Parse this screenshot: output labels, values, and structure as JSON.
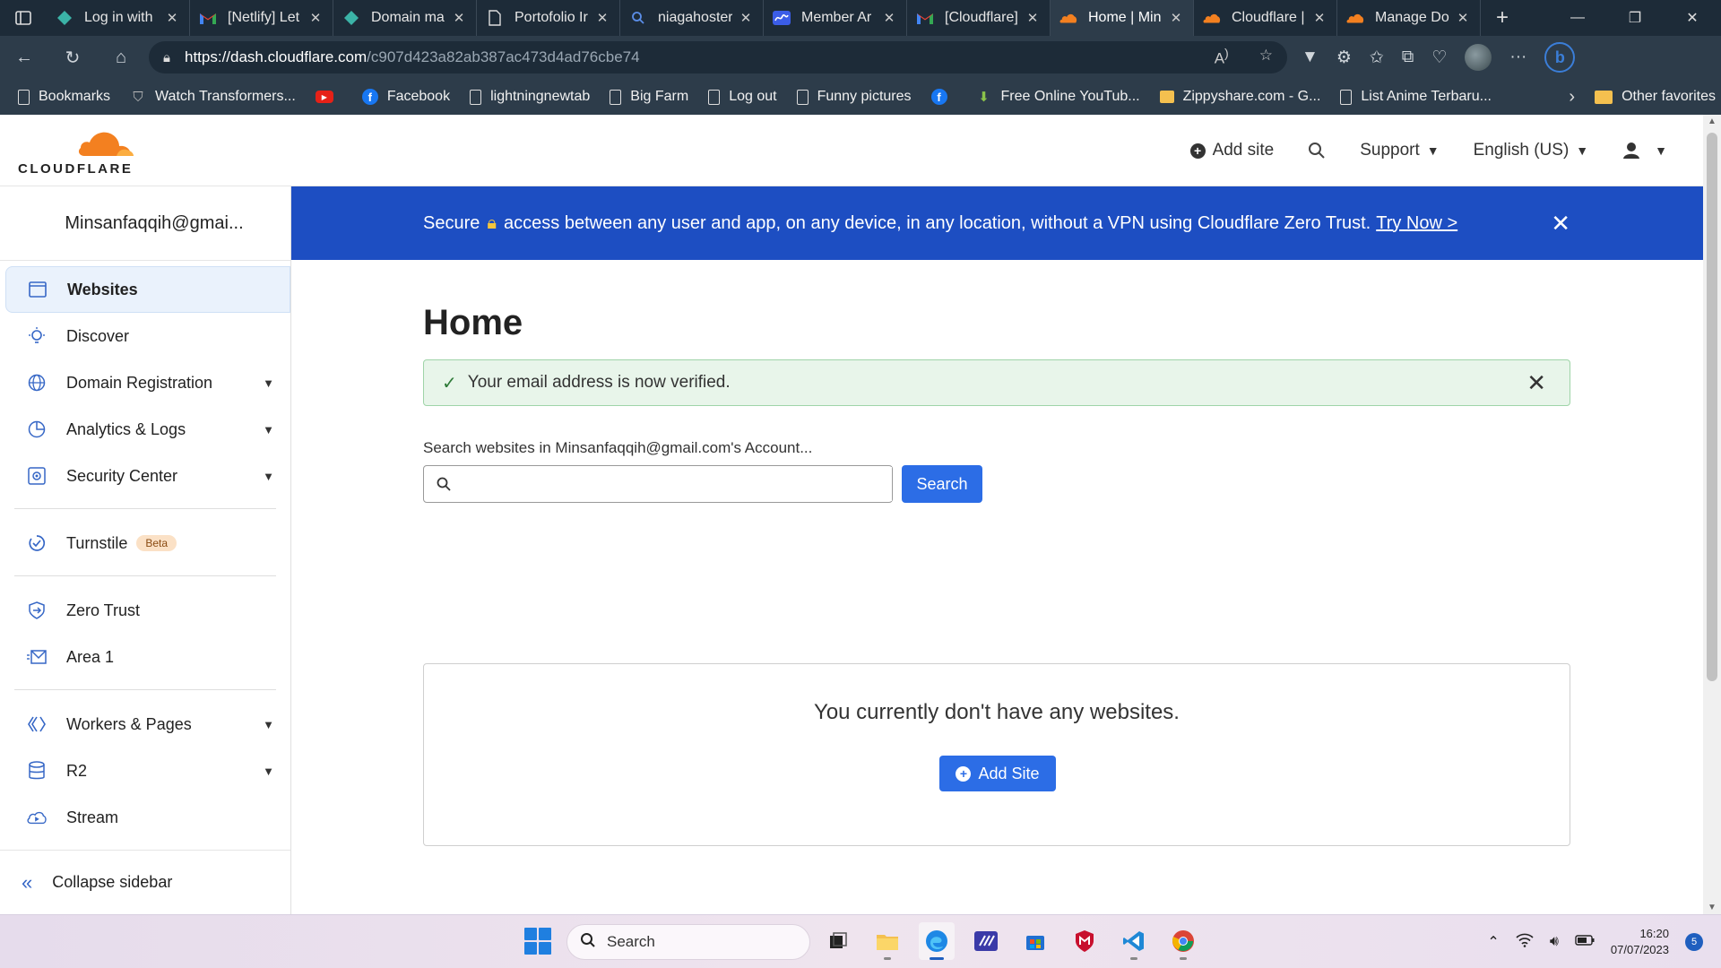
{
  "browser": {
    "tabs": [
      {
        "title": "Log in with",
        "icon": "netlify-icon",
        "active": false
      },
      {
        "title": "[Netlify] Let",
        "icon": "gmail-icon",
        "active": false
      },
      {
        "title": "Domain ma",
        "icon": "netlify-icon",
        "active": false
      },
      {
        "title": "Portofolio Ir",
        "icon": "page-icon",
        "active": false
      },
      {
        "title": "niagahoster",
        "icon": "search-icon",
        "active": false
      },
      {
        "title": "Member Ar",
        "icon": "niagahoster-icon",
        "active": false
      },
      {
        "title": "[Cloudflare]",
        "icon": "gmail-icon",
        "active": false
      },
      {
        "title": "Home | Min",
        "icon": "cloudflare-icon",
        "active": true
      },
      {
        "title": "Cloudflare |",
        "icon": "cloudflare-icon",
        "active": false
      },
      {
        "title": "Manage Do",
        "icon": "cloudflare-icon",
        "active": false
      }
    ],
    "url_host": "https://dash.cloudflare.com",
    "url_path": "/c907d423a82ab387ac473d4ad76cbe74",
    "bookmarks": [
      {
        "label": "Bookmarks",
        "icon": "page"
      },
      {
        "label": "Watch Transformers...",
        "icon": "transformers"
      },
      {
        "label": "",
        "icon": "yt"
      },
      {
        "label": "Facebook",
        "icon": "fb"
      },
      {
        "label": "lightningnewtab",
        "icon": "page"
      },
      {
        "label": "Big Farm",
        "icon": "page"
      },
      {
        "label": "Log out",
        "icon": "page"
      },
      {
        "label": "Funny pictures",
        "icon": "page"
      },
      {
        "label": "",
        "icon": "fb"
      },
      {
        "label": "Free Online YouTub...",
        "icon": "download"
      },
      {
        "label": "Zippyshare.com - G...",
        "icon": "zippy"
      },
      {
        "label": "List Anime Terbaru...",
        "icon": "page"
      }
    ],
    "other_favorites": "Other favorites"
  },
  "header": {
    "logo_text": "CLOUDFLARE",
    "add_site": "Add site",
    "support": "Support",
    "language": "English (US)"
  },
  "sidebar": {
    "account": "Minsanfaqqih@gmai...",
    "group1": [
      {
        "label": "Websites",
        "icon": "websites-icon",
        "active": true,
        "caret": false
      },
      {
        "label": "Discover",
        "icon": "lightbulb-icon",
        "active": false,
        "caret": false
      },
      {
        "label": "Domain Registration",
        "icon": "globe-icon",
        "active": false,
        "caret": true
      },
      {
        "label": "Analytics & Logs",
        "icon": "pie-chart-icon",
        "active": false,
        "caret": true
      },
      {
        "label": "Security Center",
        "icon": "security-icon",
        "active": false,
        "caret": true
      }
    ],
    "turnstile": {
      "label": "Turnstile",
      "badge": "Beta"
    },
    "group3": [
      {
        "label": "Zero Trust",
        "icon": "zero-trust-icon"
      },
      {
        "label": "Area 1",
        "icon": "mail-icon"
      }
    ],
    "group4": [
      {
        "label": "Workers & Pages",
        "icon": "workers-icon",
        "caret": true
      },
      {
        "label": "R2",
        "icon": "database-icon",
        "caret": true
      },
      {
        "label": "Stream",
        "icon": "stream-icon",
        "caret": false
      }
    ],
    "collapse": "Collapse sidebar"
  },
  "banner": {
    "before": "Secure",
    "after": "access between any user and app, on any device, in any location, without a VPN using Cloudflare Zero Trust.",
    "link": "Try Now >"
  },
  "main": {
    "title": "Home",
    "alert": "Your email address is now verified.",
    "search_label": "Search websites in Minsanfaqqih@gmail.com's Account...",
    "search_value": "",
    "search_button": "Search",
    "empty_message": "You currently don't have any websites.",
    "add_site_button": "Add Site"
  },
  "taskbar": {
    "search": "Search",
    "time": "16:20",
    "date": "07/07/2023",
    "notifications": "5"
  },
  "colors": {
    "banner": "#1d4ec2",
    "primary_button": "#2c6de6",
    "alert_bg": "#e8f5ea",
    "cloudflare_orange": "#f38020"
  }
}
